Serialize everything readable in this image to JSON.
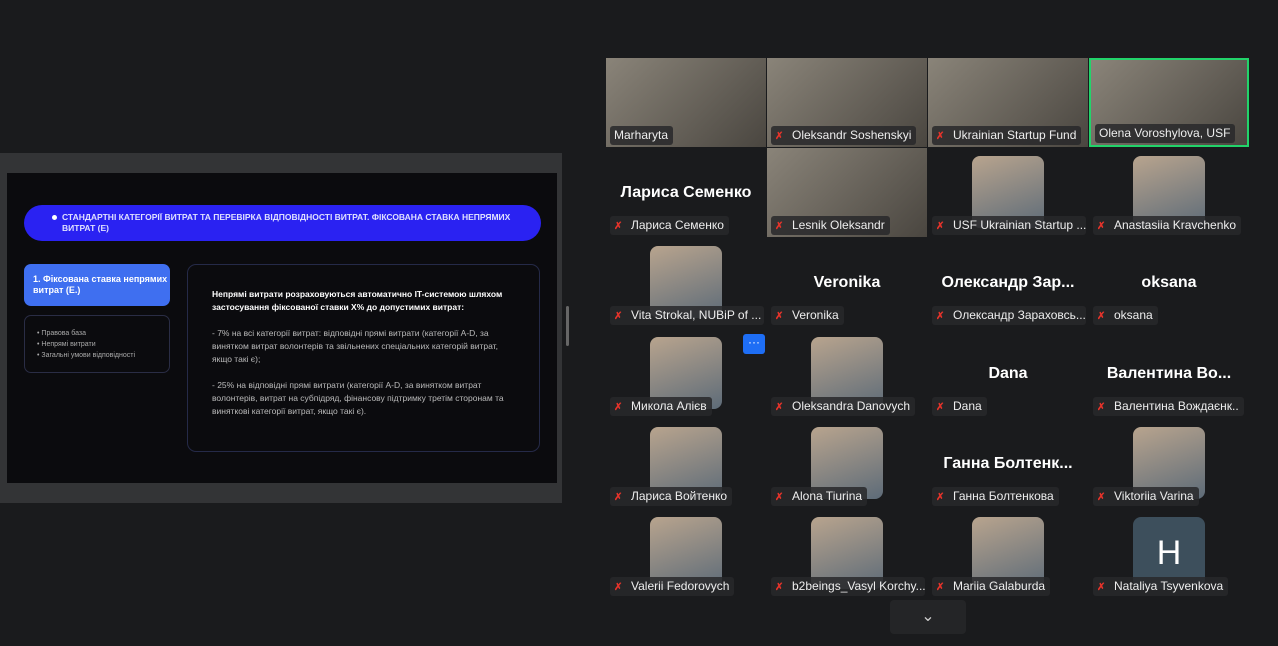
{
  "slide": {
    "banner": "СТАНДАРТНІ КАТЕГОРІЇ ВИТРАТ ТА ПЕРЕВІРКА ВІДПОВІДНОСТІ ВИТРАТ. ФІКСОВАНА СТАВКА НЕПРЯМИХ ВИТРАТ (Е)",
    "section": "1. Фіксована ставка непрямих витрат (Е.)",
    "bullets": [
      "Правова база",
      "Непрямі витрати",
      "Загальні умови відповідності"
    ],
    "intro": "Непрямі витрати розраховуються автоматично IT-системою шляхом застосування фіксованої ставки Х% до допустимих витрат:",
    "p1": "- 7% на всі категорії витрат: відповідні прямі витрати (категорії A-D, за винятком витрат волонтерів та звільнених спеціальних категорій витрат, якщо такі є);",
    "p2": "- 25% на відповідні прямі витрати (категорії A-D, за винятком витрат волонтерів, витрат на субпідряд, фінансову підтримку третім сторонам та виняткові категорії витрат, якщо такі є)."
  },
  "more_label": "···",
  "scroll_down": "⌄",
  "participants": [
    {
      "label": "Marharyta",
      "type": "video",
      "muted": false
    },
    {
      "label": "Oleksandr Soshenskyi",
      "type": "video",
      "muted": true
    },
    {
      "label": "Ukrainian Startup Fund",
      "type": "video",
      "muted": true
    },
    {
      "label": "Olena Voroshylova, USF",
      "type": "video",
      "muted": false,
      "active": true
    },
    {
      "label": "Лариса Семенко",
      "type": "name",
      "name": "Лариса Семенко",
      "muted": true
    },
    {
      "label": "Lesnik Oleksandr",
      "type": "video",
      "muted": true
    },
    {
      "label": "USF Ukrainian Startup ...",
      "type": "avatar",
      "muted": true
    },
    {
      "label": "Anastasiia Kravchenko",
      "type": "avatar",
      "muted": true
    },
    {
      "label": "Vita Strokal, NUBiP of ...",
      "type": "avatar",
      "muted": true
    },
    {
      "label": "Veronika",
      "type": "name",
      "name": "Veronika",
      "muted": true
    },
    {
      "label": "Олександр Зараховсь...",
      "type": "name",
      "name": "Олександр  Зар...",
      "muted": true
    },
    {
      "label": "oksana",
      "type": "name",
      "name": "oksana",
      "muted": true
    },
    {
      "label": "Микола Алієв",
      "type": "avatar",
      "muted": true
    },
    {
      "label": "Oleksandra Danovych",
      "type": "avatar",
      "muted": true
    },
    {
      "label": "Dana",
      "type": "name",
      "name": "Dana",
      "muted": true
    },
    {
      "label": "Валентина Вождаєнк..",
      "type": "name",
      "name": "Валентина  Во...",
      "muted": true
    },
    {
      "label": "Лариса Войтенко",
      "type": "avatar",
      "muted": true
    },
    {
      "label": "Alona Tiurina",
      "type": "avatar",
      "muted": true
    },
    {
      "label": "Ганна Болтенкова",
      "type": "name",
      "name": "Ганна  Болтенк...",
      "muted": true
    },
    {
      "label": "Viktoriia Varina",
      "type": "avatar",
      "muted": true
    },
    {
      "label": "Valerii Fedorovych",
      "type": "avatar",
      "muted": true
    },
    {
      "label": "b2beings_Vasyl Korchy...",
      "type": "avatar",
      "muted": true
    },
    {
      "label": "Mariia Galaburda",
      "type": "avatar",
      "muted": true
    },
    {
      "label": "Nataliya Tsyvenkova",
      "type": "avatar",
      "muted": true,
      "initial": "Н"
    }
  ]
}
